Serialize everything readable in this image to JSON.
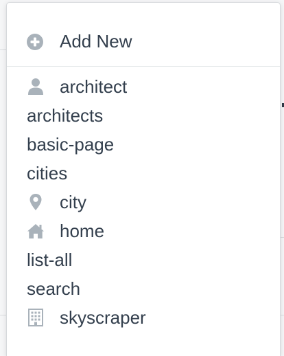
{
  "menu": {
    "add_new_label": "Add New",
    "items": [
      {
        "label": "architect",
        "icon": "user-icon"
      },
      {
        "label": "architects",
        "icon": null
      },
      {
        "label": "basic-page",
        "icon": null
      },
      {
        "label": "cities",
        "icon": null
      },
      {
        "label": "city",
        "icon": "map-marker-icon"
      },
      {
        "label": "home",
        "icon": "home-icon"
      },
      {
        "label": "list-all",
        "icon": null
      },
      {
        "label": "search",
        "icon": null
      },
      {
        "label": "skyscraper",
        "icon": "building-icon"
      }
    ]
  },
  "colors": {
    "text": "#333f4d",
    "icon": "#a9b2ba",
    "background": "#ffffff",
    "divider": "#e3e6e8"
  }
}
